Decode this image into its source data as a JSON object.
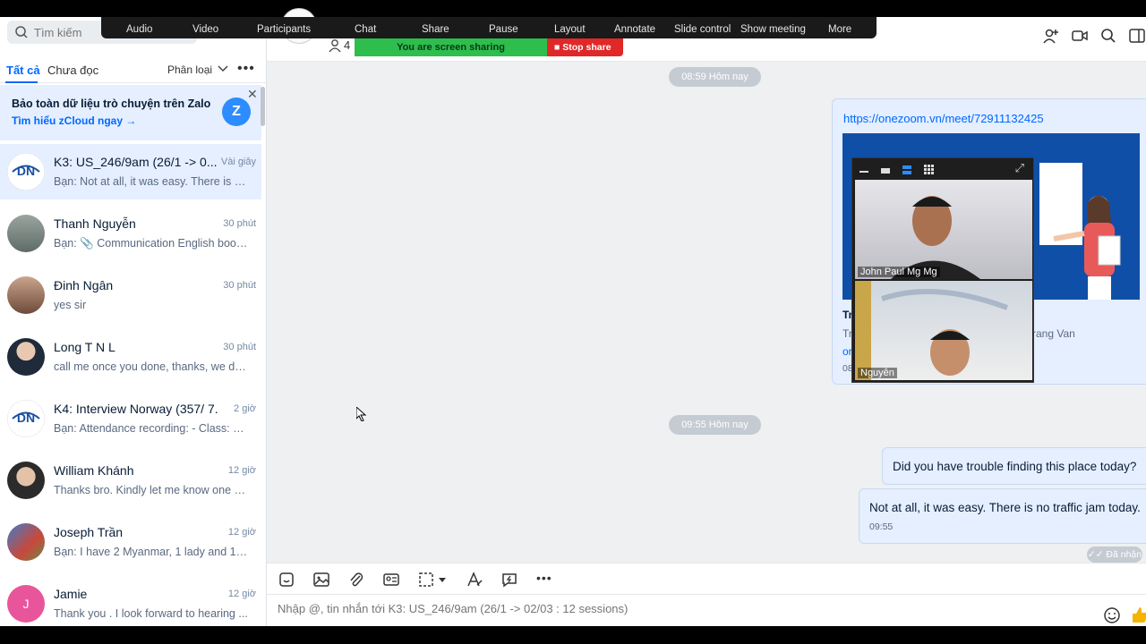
{
  "search": {
    "placeholder": "Tìm kiếm"
  },
  "filters": {
    "all": "Tất cả",
    "unread": "Chưa đọc",
    "classify": "Phân loại"
  },
  "banner": {
    "title": "Bảo toàn dữ liệu trò chuyện trên Zalo",
    "link": "Tìm hiểu zCloud ngay",
    "icon_text": "Z"
  },
  "conversations": [
    {
      "name": "K3: US_246/9am (26/1 -> 0...",
      "time": "Vài giây",
      "preview": "Bạn: Not at all, it was easy. There is n...",
      "avatar": "dn-logo"
    },
    {
      "name": "Thanh Nguyễn",
      "time": "30 phút",
      "preview": "Bạn: 📎 Communication English book...",
      "avatar": "photo"
    },
    {
      "name": "Đinh Ngân",
      "time": "30 phút",
      "preview": "yes sir",
      "avatar": "photo"
    },
    {
      "name": "Long T N L",
      "time": "30 phút",
      "preview": "call me once you done, thanks, we do...",
      "avatar": "photo"
    },
    {
      "name": "K4: Interview Norway (357/ 7...",
      "time": "2 giờ",
      "preview": "Bạn: Attendance recording: - Class: K...",
      "avatar": "dn-logo"
    },
    {
      "name": "William Khánh",
      "time": "12 giờ",
      "preview": "Thanks bro. Kindly let me know one d...",
      "avatar": "photo"
    },
    {
      "name": "Joseph Trần",
      "time": "12 giờ",
      "preview": "Bạn: I have 2 Myanmar, 1 lady and 1 b...",
      "avatar": "photo"
    },
    {
      "name": "Jamie",
      "time": "12 giờ",
      "preview": "Thank you . I look forward to hearing ...",
      "avatar": "J"
    }
  ],
  "header": {
    "member_count": "4"
  },
  "zoom_toolbar": {
    "items": [
      "Audio",
      "Video",
      "Participants",
      "Chat",
      "Share",
      "Pause",
      "Layout",
      "Annotate",
      "Slide control",
      "Show meeting",
      "More"
    ],
    "sharing_status": "You are screen sharing",
    "stop_share": "Stop share"
  },
  "chat": {
    "time_separator_1": "08:59 Hôm nay",
    "link_message": {
      "url": "https://onezoom.vn/meet/72911132425",
      "preview_title": "Tr",
      "preview_desc_left": "Tr",
      "preview_desc_right": "rang Van",
      "preview_link": "or",
      "time": "08:59"
    },
    "time_separator_2": "09:55 Hôm nay",
    "message_1": {
      "text": "Did you have trouble finding this place today?"
    },
    "message_2": {
      "text": "Not at all, it was easy. There is no traffic jam today.",
      "time": "09:55"
    },
    "status": "✓✓ Đã nhận"
  },
  "video_panel": {
    "participants": [
      {
        "name": "John Paul Mg Mg"
      },
      {
        "name": "Nguyễn"
      }
    ]
  },
  "composer": {
    "placeholder": "Nhập @, tin nhắn tới K3: US_246/9am (26/1 -> 02/03 : 12 sessions)"
  },
  "colors": {
    "accent": "#0068ff",
    "sharing_green": "#2dbe4e",
    "stop_red": "#e02828"
  }
}
